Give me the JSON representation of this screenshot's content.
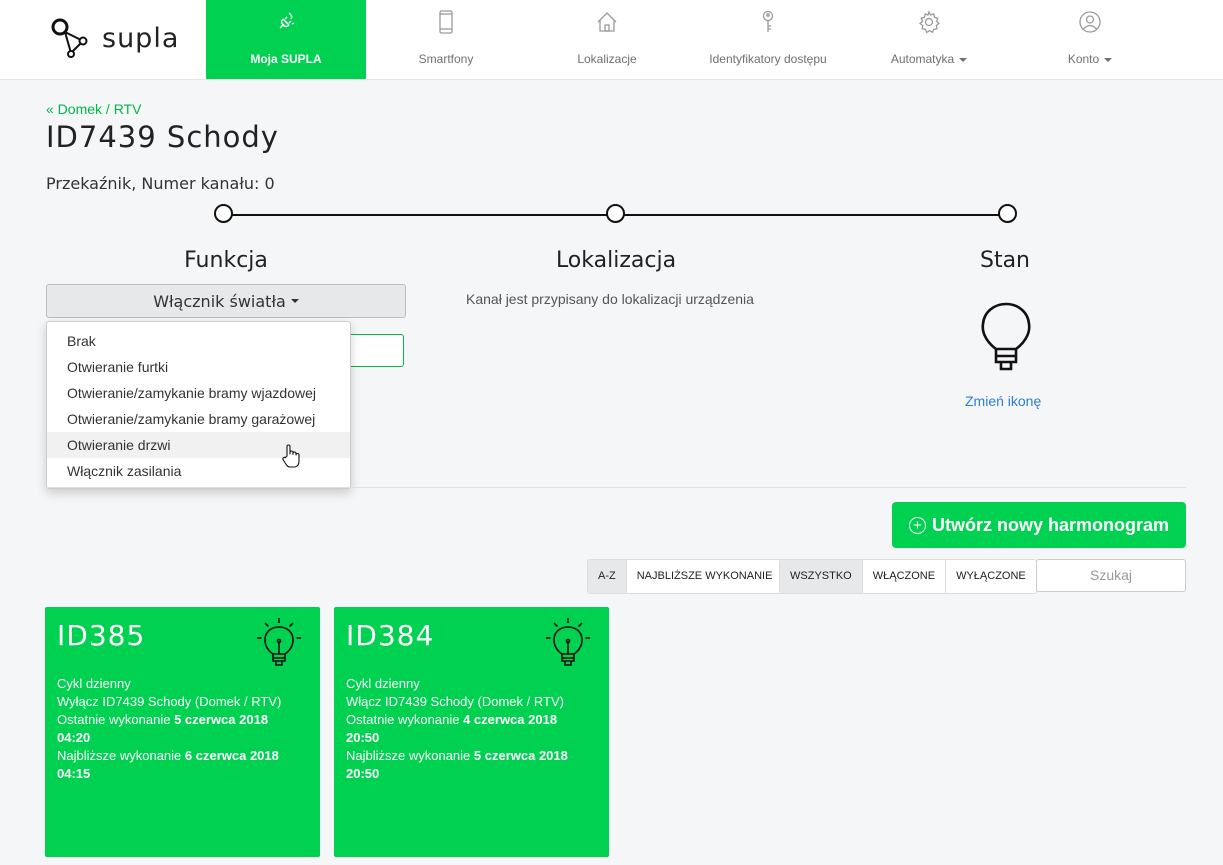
{
  "brand": {
    "name": "supla"
  },
  "nav": [
    {
      "label": "Moja SUPLA",
      "icon": "plug-icon",
      "active": true
    },
    {
      "label": "Smartfony",
      "icon": "smartphone-icon"
    },
    {
      "label": "Lokalizacje",
      "icon": "house-icon"
    },
    {
      "label": "Identyfikatory dostępu",
      "icon": "key-icon"
    },
    {
      "label": "Automatyka",
      "icon": "gear-icon",
      "dropdown": true
    },
    {
      "label": "Konto",
      "icon": "user-icon",
      "dropdown": true
    }
  ],
  "breadcrumb": "« Domek / RTV",
  "page": {
    "title": "ID7439 Schody",
    "subtitle": "Przekaźnik, Numer kanału: 0"
  },
  "sections": {
    "function": "Funkcja",
    "location": "Lokalizacja",
    "state": "Stan"
  },
  "function_select": {
    "selected": "Włącznik światła",
    "options": [
      "Brak",
      "Otwieranie furtki",
      "Otwieranie/zamykanie bramy wjazdowej",
      "Otwieranie/zamykanie bramy garażowej",
      "Otwieranie drzwi",
      "Włącznik zasilania"
    ],
    "hovered_index": 4
  },
  "location_text": "Kanał jest przypisany do lokalizacji urządzenia",
  "state": {
    "icon": "lightbulb-icon",
    "change_link": "Zmień ikonę"
  },
  "schedules": {
    "create_button": "Utwórz nowy harmonogram",
    "sort": [
      "A-Z",
      "NAJBLIŻSZE WYKONANIE"
    ],
    "filter": [
      "WSZYSTKO",
      "WŁĄCZONE",
      "WYŁĄCZONE"
    ],
    "search_placeholder": "Szukaj",
    "cards": [
      {
        "id_prefix": "ID",
        "id_number": "385",
        "mode": "Cykl dzienny",
        "action": "Wyłącz ID7439 Schody (Domek / RTV)",
        "last_label": "Ostatnie wykonanie",
        "last_date": "5 czerwca 2018",
        "last_time": "04:20",
        "next_label": "Najbliższe wykonanie",
        "next_date": "6 czerwca 2018",
        "next_time": "04:15"
      },
      {
        "id_prefix": "ID",
        "id_number": "384",
        "mode": "Cykl dzienny",
        "action": "Włącz ID7439 Schody (Domek / RTV)",
        "last_label": "Ostatnie wykonanie",
        "last_date": "4 czerwca 2018",
        "last_time": "20:50",
        "next_label": "Najbliższe wykonanie",
        "next_date": "5 czerwca 2018",
        "next_time": "20:50"
      }
    ]
  },
  "colors": {
    "accent": "#00d151",
    "link": "#2e7dd6",
    "breadcrumb": "#00b846"
  }
}
